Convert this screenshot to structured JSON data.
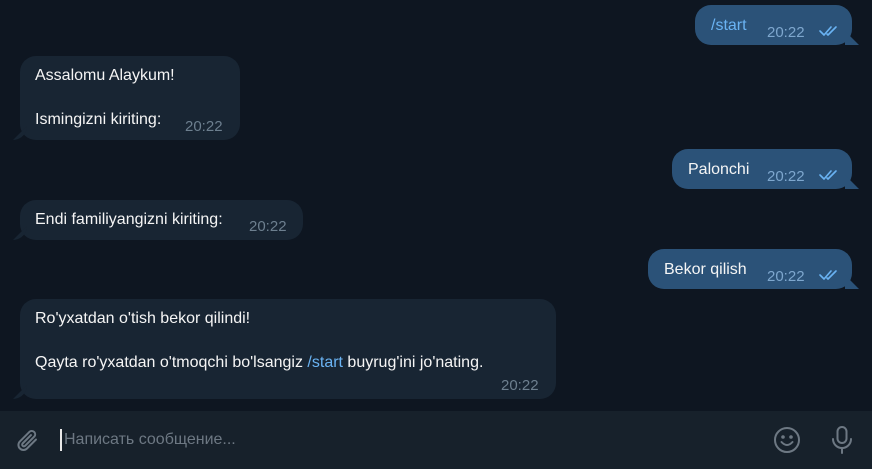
{
  "chat": {
    "messages": [
      {
        "direction": "out",
        "command": "/start",
        "time": "20:22",
        "status_icon": "double-check-icon"
      },
      {
        "direction": "in",
        "line1": "Assalomu Alaykum!",
        "line2": "Ismingizni kiriting:",
        "time": "20:22"
      },
      {
        "direction": "out",
        "text": "Palonchi",
        "time": "20:22",
        "status_icon": "double-check-icon"
      },
      {
        "direction": "in",
        "text": "Endi familiyangizni kiriting:",
        "time": "20:22"
      },
      {
        "direction": "out",
        "text": "Bekor qilish",
        "time": "20:22",
        "status_icon": "double-check-icon"
      },
      {
        "direction": "in",
        "line1": "Ro'yxatdan o'tish bekor qilindi!",
        "line2_pre": "Qayta ro'yxatdan o'tmoqchi bo'lsangiz ",
        "line2_cmd": "/start",
        "line2_post": " buyrug'ini jo'nating.",
        "time": "20:22"
      }
    ]
  },
  "composer": {
    "placeholder": "Написать сообщение...",
    "attach_icon": "paperclip-icon",
    "emoji_icon": "smile-icon",
    "voice_icon": "microphone-icon"
  },
  "colors": {
    "background": "#0e1621",
    "incoming_bubble": "#182533",
    "outgoing_bubble": "#2b5278",
    "link": "#6ab3f3",
    "composer": "#17212b"
  }
}
